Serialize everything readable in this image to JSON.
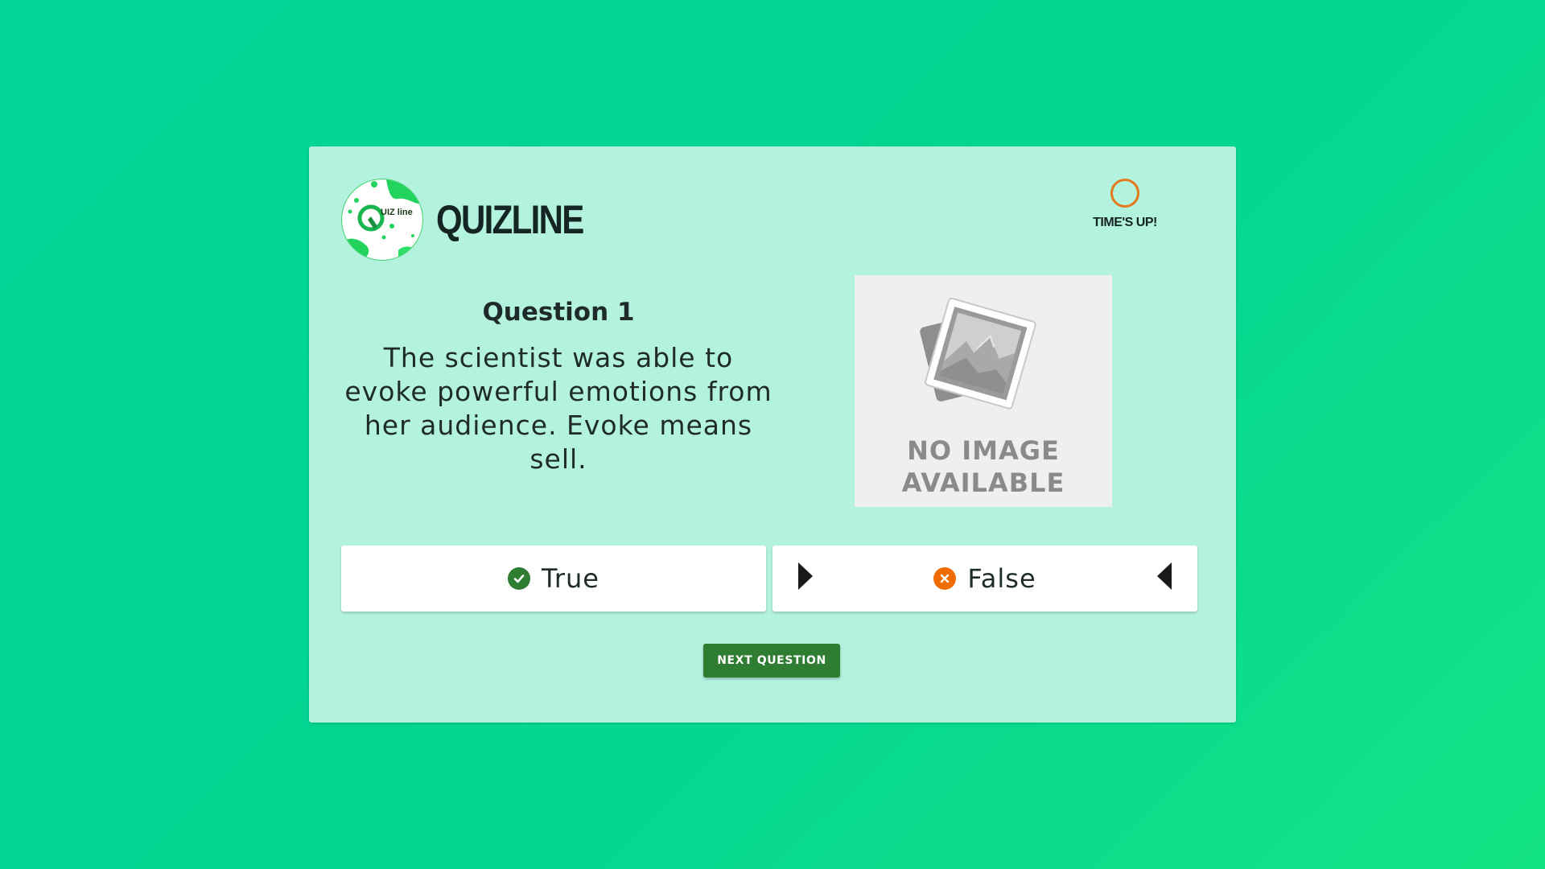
{
  "brand": {
    "name": "QUIZLINE",
    "logo_text": "UIZ line"
  },
  "timer": {
    "label": "TIME'S UP!"
  },
  "question": {
    "title": "Question 1",
    "text": "The scientist was able to evoke powerful emotions from her audience. Evoke means sell."
  },
  "image_placeholder": {
    "line1": "NO IMAGE",
    "line2": "AVAILABLE"
  },
  "answers": [
    {
      "label": "True",
      "icon": "check-circle-icon",
      "color": "#2e7d32"
    },
    {
      "label": "False",
      "icon": "cancel-circle-icon",
      "color": "#ef6c00"
    }
  ],
  "next_button": {
    "label": "NEXT QUESTION"
  },
  "colors": {
    "background": "#00d596",
    "card": "#b3f2dd",
    "primary": "#2e7d32",
    "timer": "#e3791c"
  }
}
